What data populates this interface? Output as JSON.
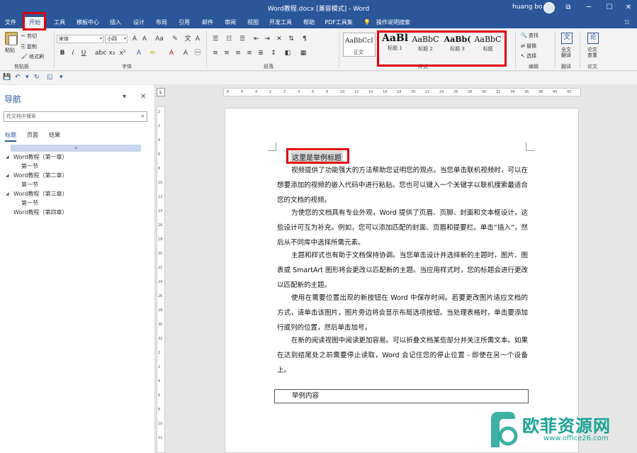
{
  "titlebar": {
    "title": "Word教程.docx [兼容模式] - Word",
    "user": "huang bo",
    "buttons": [
      "⧉",
      "─",
      "☐",
      "✕"
    ]
  },
  "tabs": [
    "文件",
    "开始",
    "工具",
    "模板中心",
    "插入",
    "设计",
    "布局",
    "引用",
    "邮件",
    "审阅",
    "视图",
    "开发工具",
    "帮助",
    "PDF工具集",
    "操作说明搜索"
  ],
  "active_tab": "开始",
  "ribbon": {
    "clipboard": {
      "label": "剪贴板",
      "paste": "粘贴",
      "cut": "剪切",
      "copy": "复制",
      "format_painter": "格式刷"
    },
    "font": {
      "label": "字体",
      "font_name": "宋体",
      "font_size": "小四",
      "bold": "B",
      "italic": "I",
      "underline": "U"
    },
    "paragraph": {
      "label": "段落"
    },
    "styles": {
      "label": "样式",
      "items": [
        {
          "sample": "AaBbCcI",
          "name": "正文"
        },
        {
          "sample": "AaBl",
          "name": "标题 1"
        },
        {
          "sample": "AaBbC",
          "name": "标题 2"
        },
        {
          "sample": "AaBb(",
          "name": "标题 3"
        },
        {
          "sample": "AaBbC",
          "name": "标题"
        }
      ]
    },
    "editing": {
      "label": "编辑",
      "find": "查找",
      "replace": "替换",
      "select": "选择"
    },
    "translate": {
      "label": "翻译",
      "btn": "全文翻译"
    },
    "paper": {
      "label": "论文",
      "btn": "论文查重"
    }
  },
  "nav": {
    "title": "导航",
    "search_placeholder": "在文档中搜索",
    "tabs": [
      "标题",
      "页面",
      "结果"
    ],
    "items": [
      {
        "text": "Word教程（第一章）",
        "level": 1
      },
      {
        "text": "第一节",
        "level": 2
      },
      {
        "text": "Word教程（第二章）",
        "level": 1
      },
      {
        "text": "第一节",
        "level": 2
      },
      {
        "text": "Word教程（第三章）",
        "level": 1
      },
      {
        "text": "第一节",
        "level": 2
      },
      {
        "text": "Word教程（第四章）",
        "level": 1
      }
    ]
  },
  "document": {
    "heading": "这里是举例标题",
    "paragraphs": [
      "视频提供了功能强大的方法帮助您证明您的观点。当您单击联机视频时，可以在想要添加的视频的嵌入代码中进行粘贴。您也可以键入一个关键字以联机搜索最适合您的文档的视频。",
      "为使您的文档具有专业外观，Word 提供了页眉、页脚、封面和文本框设计，这些设计可互为补充。例如，您可以添加匹配的封面、页眉和提要栏。单击“插入”，然后从不同库中选择所需元素。",
      "主题和样式也有助于文档保持协调。当您单击设计并选择新的主题时，图片、图表或 SmartArt 图形将会更改以匹配新的主题。当应用样式时，您的标题会进行更改以匹配新的主题。",
      "使用在需要位置出现的新按钮在 Word 中保存时间。若要更改图片适应文档的方式，请单击该图片，图片旁边将会显示布局选项按钮。当处理表格时，单击要添加行或列的位置，然后单击加号。",
      "在新的阅读视图中阅读更加容易。可以折叠文档某些部分并关注所需文本。如果在达到结尾处之前需要停止读取，Word 会记住您的停止位置 - 即使在另一个设备上。"
    ],
    "sample_box": "举例内容"
  },
  "watermark": {
    "brand": "欧菲资源网",
    "site": "www.office26.com"
  },
  "colors": {
    "accent": "#2b579a",
    "highlight": "#e0000d",
    "watermark": "#1aa394"
  }
}
